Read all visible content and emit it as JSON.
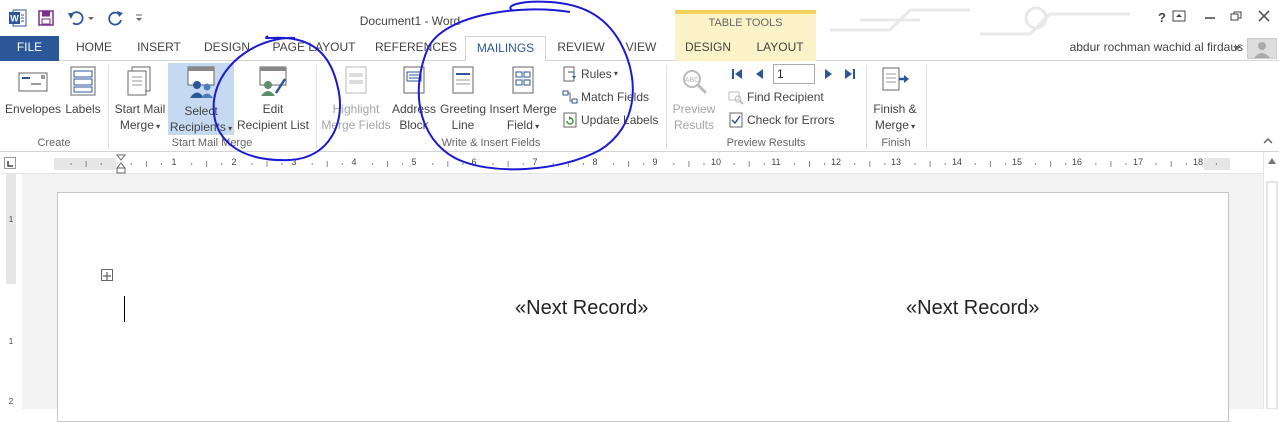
{
  "window": {
    "title": "Document1 - Word",
    "contextual_group": "TABLE TOOLS",
    "help_label": "?",
    "user": "abdur rochman wachid al firdaus"
  },
  "tabs": [
    {
      "label": "FILE"
    },
    {
      "label": "HOME"
    },
    {
      "label": "INSERT"
    },
    {
      "label": "DESIGN"
    },
    {
      "label": "PAGE LAYOUT"
    },
    {
      "label": "REFERENCES"
    },
    {
      "label": "MAILINGS",
      "selected": true
    },
    {
      "label": "REVIEW"
    },
    {
      "label": "VIEW"
    },
    {
      "label": "DESIGN"
    },
    {
      "label": "LAYOUT"
    }
  ],
  "ribbon": {
    "create": {
      "label": "Create",
      "envelopes": "Envelopes",
      "labels": "Labels"
    },
    "start_mail_merge": {
      "label": "Start Mail Merge",
      "start_line1": "Start Mail",
      "start_line2": "Merge",
      "select_line1": "Select",
      "select_line2": "Recipients",
      "edit_line1": "Edit",
      "edit_line2": "Recipient List"
    },
    "write_insert": {
      "label": "Write & Insert Fields",
      "highlight_line1": "Highlight",
      "highlight_line2": "Merge Fields",
      "address_line1": "Address",
      "address_line2": "Block",
      "greeting_line1": "Greeting",
      "greeting_line2": "Line",
      "insert_line1": "Insert Merge",
      "insert_line2": "Field",
      "rules": "Rules",
      "match_fields": "Match Fields",
      "update_labels": "Update Labels"
    },
    "preview": {
      "label": "Preview Results",
      "preview_line1": "Preview",
      "preview_line2": "Results",
      "record_number": "1",
      "find_recipient": "Find Recipient",
      "check_errors": "Check for Errors"
    },
    "finish": {
      "label": "Finish",
      "finish_line1": "Finish &",
      "finish_line2": "Merge"
    }
  },
  "ruler": {
    "numbers": [
      "1",
      "2",
      "3",
      "4",
      "5",
      "6",
      "7",
      "8",
      "9",
      "10",
      "11",
      "12",
      "13",
      "14",
      "15",
      "16",
      "17",
      "18"
    ]
  },
  "document": {
    "field1": "«Next Record»",
    "field2": "«Next Record»"
  },
  "colors": {
    "accent": "#2b579a",
    "contextual": "#fbf3c7",
    "annotation_ink": "#1a1ad4"
  }
}
